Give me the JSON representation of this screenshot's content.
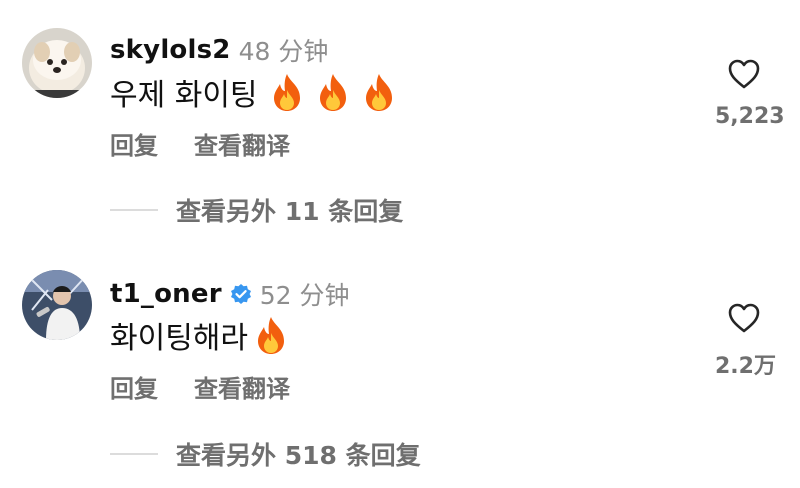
{
  "comments": [
    {
      "username": "skylols2",
      "time": "48 分钟",
      "verified": false,
      "text": "우제 화이팅",
      "emoji_count": 3,
      "reply_label": "回复",
      "translate_label": "查看翻译",
      "likes": "5,223",
      "view_replies": "查看另外 11 条回复"
    },
    {
      "username": "t1_oner",
      "time": "52 分钟",
      "verified": true,
      "text": "화이팅해라",
      "emoji_count": 1,
      "reply_label": "回复",
      "translate_label": "查看翻译",
      "likes": "2.2万",
      "view_replies": "查看另外 518 条回复"
    }
  ],
  "icons": {
    "like": "heart-outline-icon",
    "emoji": "fire-emoji",
    "verified": "verified-badge-icon"
  },
  "colors": {
    "secondary_text": "#8e8e8e",
    "action_text": "#6f6f6f",
    "verified_blue": "#3897f0",
    "flame_outer": "#f25f0e",
    "flame_inner": "#ffc83a"
  }
}
